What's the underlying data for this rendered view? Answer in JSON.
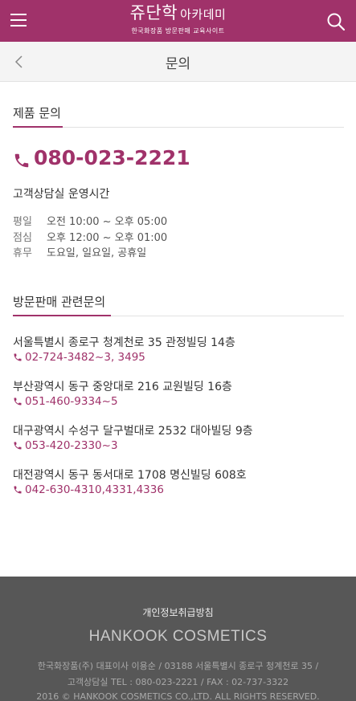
{
  "header": {
    "logo_brand": "쥬단학",
    "logo_academy": "아카데미",
    "logo_tagline": "한국화장품 방문판매 교육사이트",
    "colors": {
      "brand": "#a0326a"
    },
    "icons": {
      "menu": "hamburger-menu-icon",
      "search": "search-icon"
    }
  },
  "subheader": {
    "title": "문의",
    "back_icon": "chevron-left-icon"
  },
  "product_inquiry": {
    "title": "제품 문의",
    "phone": "080-023-2221",
    "hours_title": "고객상담실 운영시간",
    "hours": [
      {
        "label": "평일",
        "value": "오전 10:00 ~ 오후 05:00"
      },
      {
        "label": "점심",
        "value": "오후 12:00 ~ 오후 01:00"
      },
      {
        "label": "휴무",
        "value": "도요일, 일요일, 공휴일"
      }
    ]
  },
  "visit_sales": {
    "title": "방문판매 관련문의",
    "branches": [
      {
        "address": "서울특별시 종로구 청계천로 35 관정빌딩 14층",
        "phone": "02-724-3482~3, 3495"
      },
      {
        "address": "부산광역시 동구 중앙대로 216 교원빌딩 16층",
        "phone": "051-460-9334~5"
      },
      {
        "address": "대구광역시 수성구 달구벌대로 2532 대아빌딩 9층",
        "phone": "053-420-2330~3"
      },
      {
        "address": "대전광역시 동구 동서대로 1708 명신빌딩 608호",
        "phone": "042-630-4310,4331,4336"
      }
    ]
  },
  "footer": {
    "privacy_link": "개인정보취급방침",
    "company_logo": "HANKOOK COSMETICS",
    "info_line1": "한국화장품(주) 대표이사 이용순 / 03188 서울특별시 종로구 청계천로 35 /",
    "info_line2": "고객상담실 TEL : 080-023-2221 / FAX : 02-737-3322",
    "info_line3": "2016 © HANKOOK COSMETICS CO.,LTD. ALL RIGHTS RESERVED."
  }
}
